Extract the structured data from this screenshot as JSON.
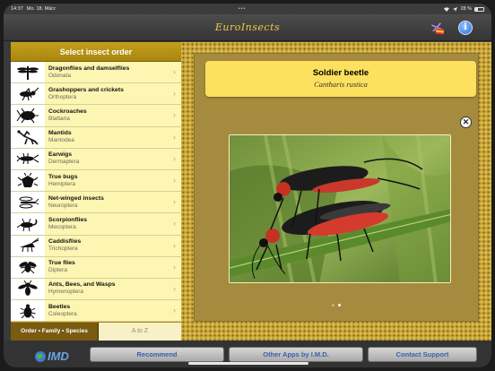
{
  "status": {
    "time": "14:37",
    "date": "Mo. 18. März",
    "battery": "28 %",
    "battery_fill": 0.28
  },
  "app": {
    "title": "EuroInsects"
  },
  "sidebar": {
    "header": "Select insect order",
    "items": [
      {
        "name": "Dragonflies and damselflies",
        "latin": "Odonata",
        "icon": "dragonfly-icon"
      },
      {
        "name": "Grashoppers and crickets",
        "latin": "Orthoptera",
        "icon": "grasshopper-icon"
      },
      {
        "name": "Cockroaches",
        "latin": "Blattaria",
        "icon": "cockroach-icon"
      },
      {
        "name": "Mantids",
        "latin": "Mantodea",
        "icon": "mantis-icon"
      },
      {
        "name": "Earwigs",
        "latin": "Dermaptera",
        "icon": "earwig-icon"
      },
      {
        "name": "True bugs",
        "latin": "Hemiptera",
        "icon": "bug-icon"
      },
      {
        "name": "Net-winged insects",
        "latin": "Neuroptera",
        "icon": "lacewing-icon"
      },
      {
        "name": "Scorpionflies",
        "latin": "Mecoptera",
        "icon": "scorpionfly-icon"
      },
      {
        "name": "Caddisflies",
        "latin": "Trichoptera",
        "icon": "caddisfly-icon"
      },
      {
        "name": "True flies",
        "latin": "Diptera",
        "icon": "fly-icon"
      },
      {
        "name": "Ants, Bees, and Wasps",
        "latin": "Hymenoptera",
        "icon": "wasp-icon"
      },
      {
        "name": "Beetles",
        "latin": "Coleoptera",
        "icon": "beetle-icon"
      }
    ],
    "segments": {
      "active": "Order • Family • Species",
      "inactive": "A to Z"
    }
  },
  "detail": {
    "common_name": "Soldier beetle",
    "latin_name": "Cantharis rustica",
    "page_count": 2,
    "current_page": 2
  },
  "bottom": {
    "logo_text": "IMD",
    "buttons": [
      "Recommend",
      "Other Apps by I.M.D.",
      "Contact Support"
    ]
  },
  "colors": {
    "accent_gold": "#f1c73c",
    "list_yellow": "#fdf5b2",
    "link_blue": "#3c5fa8"
  }
}
